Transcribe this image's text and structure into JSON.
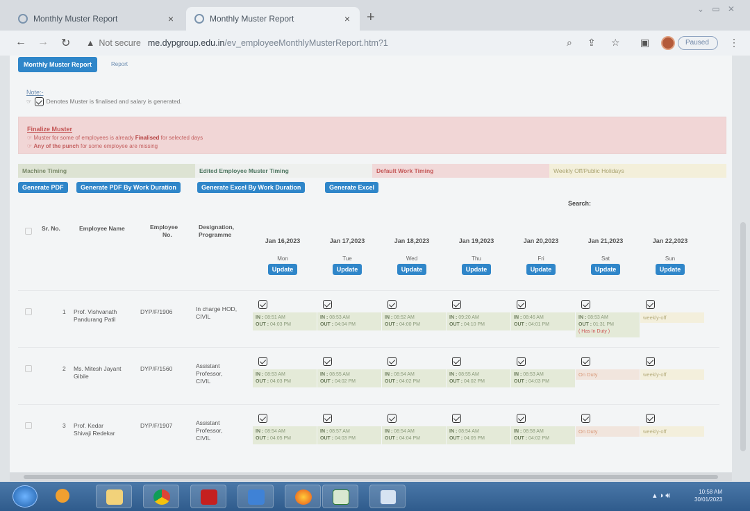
{
  "browser": {
    "tabs": [
      {
        "title": "Monthly Muster Report"
      },
      {
        "title": "Monthly Muster Report"
      }
    ],
    "not_secure": "Not secure",
    "url_domain": "me.dypgroup.edu.in",
    "url_path": "/ev_employeeMonthlyMusterReport.htm?1",
    "profile_label": "Paused"
  },
  "page": {
    "top_tab": "Monthly Muster Report",
    "top_tab2": "Report",
    "note_title": "Note:-",
    "note_text": "Denotes Muster is finalised and salary is generated.",
    "alert_title": "Finalize Muster",
    "alert_line1_a": "Muster for some of employees is already",
    "alert_line1_b": "Finalised",
    "alert_line1_c": "for selected days",
    "alert_line2_a": "Any of the punch",
    "alert_line2_b": "for some employee are missing",
    "legend": [
      "Machine Timing",
      "Edited Employee Muster Timing",
      "Default Work Timing",
      "Weekly Off/Public Holidays"
    ],
    "buttons": [
      "Generate PDF",
      "Generate PDF By Work Duration",
      "Generate Excel By Work Duration",
      "Generate Excel"
    ],
    "search_label": "Search:",
    "update_label": "Update"
  },
  "table": {
    "headers": {
      "sr": "Sr. No.",
      "name": "Employee Name",
      "emp_no_1": "Employee",
      "emp_no_2": "No.",
      "desig_1": "Designation,",
      "desig_2": "Programme"
    },
    "days": [
      {
        "date": "Jan 16,2023",
        "weekday": "Mon"
      },
      {
        "date": "Jan 17,2023",
        "weekday": "Tue"
      },
      {
        "date": "Jan 18,2023",
        "weekday": "Wed"
      },
      {
        "date": "Jan 19,2023",
        "weekday": "Thu"
      },
      {
        "date": "Jan 20,2023",
        "weekday": "Fri"
      },
      {
        "date": "Jan 21,2023",
        "weekday": "Sat"
      },
      {
        "date": "Jan 22,2023",
        "weekday": "Sun"
      }
    ],
    "rows": [
      {
        "sr": "1",
        "name_1": "Prof. Vishvanath",
        "name_2": "Pandurang Patil",
        "emp_no": "DYP/F/1906",
        "desig_1": "In charge HOD,",
        "desig_2": "CIVIL",
        "cells": [
          {
            "type": "time",
            "in": "08:51 AM",
            "out": "04:03 PM"
          },
          {
            "type": "time",
            "in": "08:53 AM",
            "out": "04:04 PM"
          },
          {
            "type": "time",
            "in": "08:52 AM",
            "out": "04:00 PM"
          },
          {
            "type": "time",
            "in": "09:20 AM",
            "out": "04:10 PM"
          },
          {
            "type": "time",
            "in": "08:46 AM",
            "out": "04:01 PM"
          },
          {
            "type": "time",
            "in": "08:53 AM",
            "out": "01:31 PM",
            "extra": "( Has In Duty )"
          },
          {
            "type": "weekly",
            "text": "weekly-off"
          }
        ]
      },
      {
        "sr": "2",
        "name_1": "Ms. Mitesh Jayant",
        "name_2": "Gibile",
        "emp_no": "DYP/F/1560",
        "desig_1": "Assistant",
        "desig_2": "Professor,",
        "desig_3": "CIVIL",
        "cells": [
          {
            "type": "time",
            "in": "08:53 AM",
            "out": "04:03 PM"
          },
          {
            "type": "time",
            "in": "08:55 AM",
            "out": "04:02 PM"
          },
          {
            "type": "time",
            "in": "08:54 AM",
            "out": "04:02 PM"
          },
          {
            "type": "time",
            "in": "08:55 AM",
            "out": "04:02 PM"
          },
          {
            "type": "time",
            "in": "08:53 AM",
            "out": "04:03 PM"
          },
          {
            "type": "onduty",
            "text": "On Duty"
          },
          {
            "type": "weekly",
            "text": "weekly-off"
          }
        ]
      },
      {
        "sr": "3",
        "name_1": "Prof. Kedar",
        "name_2": "Shivaji Redekar",
        "emp_no": "DYP/F/1907",
        "desig_1": "Assistant",
        "desig_2": "Professor,",
        "desig_3": "CIVIL",
        "cells": [
          {
            "type": "time",
            "in": "08:54 AM",
            "out": "04:05 PM"
          },
          {
            "type": "time",
            "in": "08:57 AM",
            "out": "04:03 PM"
          },
          {
            "type": "time",
            "in": "08:54 AM",
            "out": "04:04 PM"
          },
          {
            "type": "time",
            "in": "08:54 AM",
            "out": "04:05 PM"
          },
          {
            "type": "time",
            "in": "08:58 AM",
            "out": "04:02 PM"
          },
          {
            "type": "onduty",
            "text": "On Duty"
          },
          {
            "type": "weekly",
            "text": "weekly-off"
          }
        ]
      }
    ]
  },
  "taskbar": {
    "time": "10:58 AM",
    "date": "30/01/2023"
  }
}
